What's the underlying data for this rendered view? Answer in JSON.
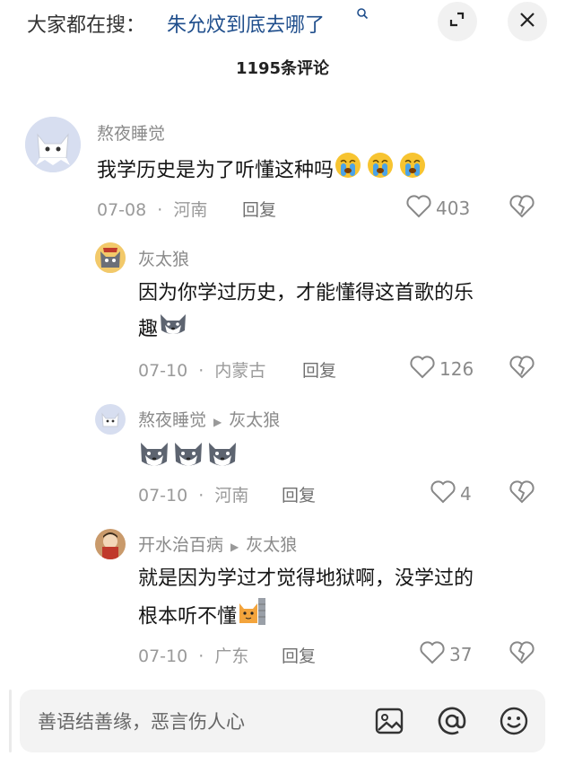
{
  "header": {
    "search_prefix": "大家都在搜：",
    "search_term": "朱允炆到底去哪了",
    "comment_count": "1195条评论"
  },
  "comments": [
    {
      "nickname": "熬夜睡觉",
      "text": "我学历史是为了听懂这种吗",
      "date": "07-08",
      "sep": "·",
      "region": "河南",
      "reply_label": "回复",
      "likes": "403"
    }
  ],
  "replies": [
    {
      "nickname": "灰太狼",
      "text_line1": "因为你学过历史，才能懂得这首歌的乐",
      "text_line2": "趣",
      "date": "07-10",
      "sep": "·",
      "region": "内蒙古",
      "reply_label": "回复",
      "likes": "126"
    },
    {
      "nickname": "熬夜睡觉",
      "reply_to": "灰太狼",
      "date": "07-10",
      "sep": "·",
      "region": "河南",
      "reply_label": "回复",
      "likes": "4"
    },
    {
      "nickname": "开水治百病",
      "reply_to": "灰太狼",
      "text_line1": "就是因为学过才觉得地狱啊，没学过的",
      "text_line2": "根本听不懂",
      "date": "07-10",
      "sep": "·",
      "region": "广东",
      "reply_label": "回复",
      "likes": "37"
    }
  ],
  "input": {
    "placeholder": "善语结善缘，恶言伤人心"
  },
  "colors": {
    "link_blue": "#1f4e8c",
    "muted_gray": "#8a8a8a"
  }
}
